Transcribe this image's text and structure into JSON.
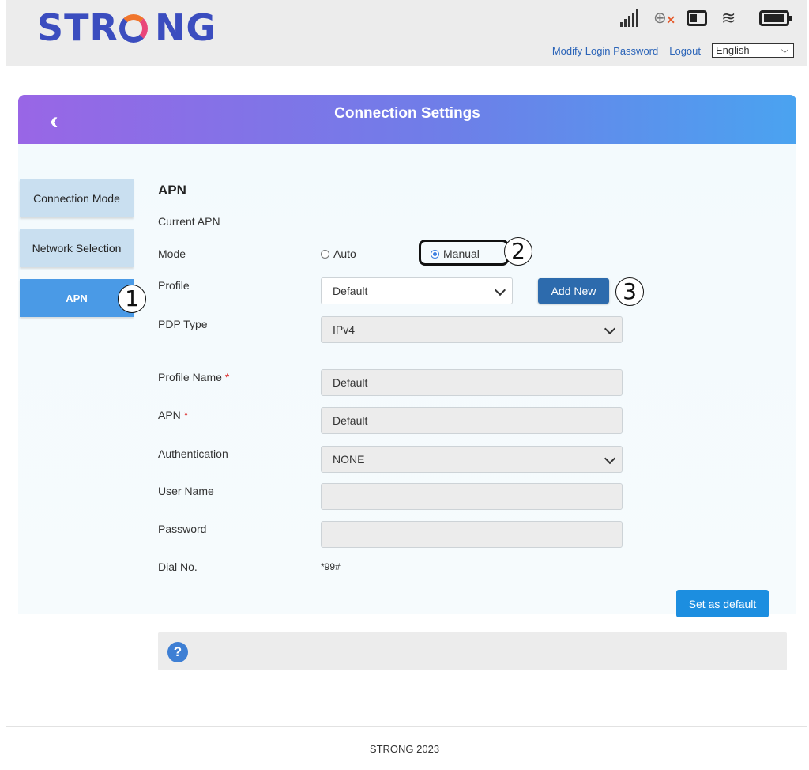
{
  "header": {
    "logo_text": "STRONG",
    "links": {
      "modify_password": "Modify Login Password",
      "logout": "Logout"
    },
    "language": "English",
    "status_icons": [
      "signal-icon",
      "globe-disconnected-icon",
      "sim-icon",
      "wifi-icon",
      "battery-icon"
    ]
  },
  "banner": {
    "title": "Connection Settings",
    "back_glyph": "‹"
  },
  "sidebar": {
    "items": [
      {
        "label": "Connection Mode",
        "active": false
      },
      {
        "label": "Network Selection",
        "active": false
      },
      {
        "label": "APN",
        "active": true
      }
    ]
  },
  "callouts": {
    "one": "1",
    "two": "2",
    "three": "3"
  },
  "apn": {
    "section_title": "APN",
    "current_apn_label": "Current APN",
    "mode_label": "Mode",
    "mode_options": {
      "auto": "Auto",
      "manual": "Manual"
    },
    "mode_selected": "Manual",
    "profile_label": "Profile",
    "profile_value": "Default",
    "add_new_label": "Add New",
    "pdp_type_label": "PDP Type",
    "pdp_type_value": "IPv4",
    "profile_name_label": "Profile Name",
    "profile_name_value": "Default",
    "apn_label": "APN",
    "apn_value": "Default",
    "required_mark": "*",
    "authentication_label": "Authentication",
    "authentication_value": "NONE",
    "user_name_label": "User Name",
    "user_name_value": "",
    "password_label": "Password",
    "password_value": "",
    "dial_no_label": "Dial No.",
    "dial_no_value": "*99#",
    "set_default_label": "Set as default"
  },
  "help": {
    "icon_glyph": "?"
  },
  "footer": {
    "text": "STRONG 2023"
  },
  "colors": {
    "brand": "#3b4dbf",
    "accent_orange": "#f0752c",
    "sidebar_active": "#4a9ae6",
    "button_primary": "#1c8ee0",
    "button_add": "#2d6bad"
  }
}
